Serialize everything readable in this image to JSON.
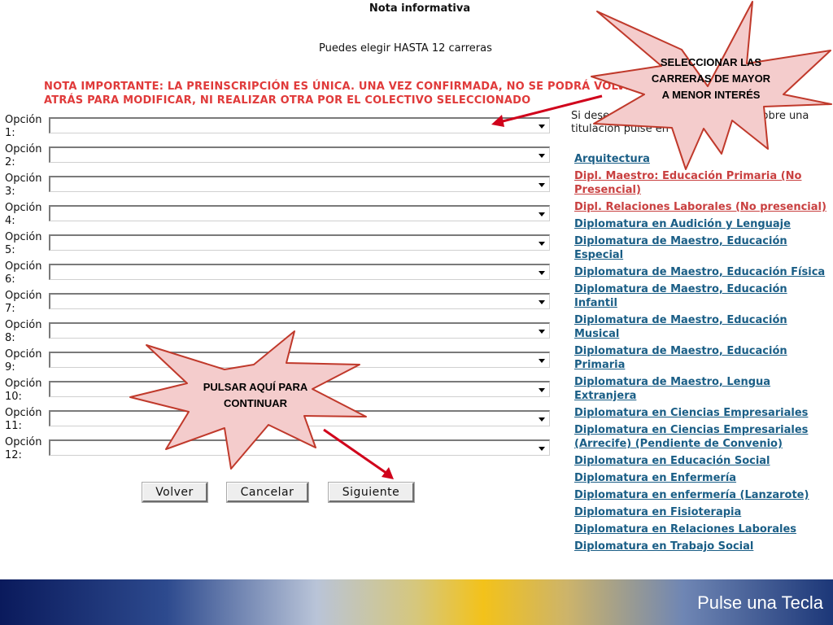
{
  "header": {
    "title": "Nota informativa",
    "subtitle": "Puedes elegir HASTA 12 carreras",
    "warning": "NOTA IMPORTANTE: LA PREINSCRIPCIÓN ES ÚNICA. UNA VEZ CONFIRMADA, NO SE PODRÁ VOLVER ATRÁS PARA MODIFICAR, NI REALIZAR OTRA POR EL COLECTIVO SELECCIONADO"
  },
  "options": [
    {
      "label": "Opción 1:",
      "value": ""
    },
    {
      "label": "Opción 2:",
      "value": ""
    },
    {
      "label": "Opción 3:",
      "value": ""
    },
    {
      "label": "Opción 4:",
      "value": ""
    },
    {
      "label": "Opción 5:",
      "value": ""
    },
    {
      "label": "Opción 6:",
      "value": ""
    },
    {
      "label": "Opción 7:",
      "value": ""
    },
    {
      "label": "Opción 8:",
      "value": ""
    },
    {
      "label": "Opción 9:",
      "value": ""
    },
    {
      "label": "Opción 10:",
      "value": ""
    },
    {
      "label": "Opción 11:",
      "value": ""
    },
    {
      "label": "Opción 12:",
      "value": ""
    }
  ],
  "buttons": {
    "back": "Volver",
    "cancel": "Cancelar",
    "next": "Siguiente"
  },
  "info_text": "Si desea conocer más información sobre una titulación pulse en su enlace",
  "degrees": [
    {
      "label": "Arquitectura",
      "color": "blue"
    },
    {
      "label": "Dipl. Maestro: Educación Primaria (No Presencial)",
      "color": "red"
    },
    {
      "label": "Dipl. Relaciones Laborales (No presencial)",
      "color": "red"
    },
    {
      "label": "Diplomatura en Audición y Lenguaje",
      "color": "blue"
    },
    {
      "label": "Diplomatura de Maestro, Educación Especial",
      "color": "blue"
    },
    {
      "label": "Diplomatura de Maestro, Educación Física",
      "color": "blue"
    },
    {
      "label": "Diplomatura de Maestro, Educación Infantil",
      "color": "blue"
    },
    {
      "label": "Diplomatura de Maestro, Educación Musical",
      "color": "blue"
    },
    {
      "label": "Diplomatura de Maestro, Educación Primaria",
      "color": "blue"
    },
    {
      "label": "Diplomatura de Maestro, Lengua Extranjera",
      "color": "blue"
    },
    {
      "label": "Diplomatura en Ciencias Empresariales",
      "color": "blue"
    },
    {
      "label": "Diplomatura en Ciencias Empresariales (Arrecife) (Pendiente de Convenio)",
      "color": "blue"
    },
    {
      "label": "Diplomatura en Educación Social",
      "color": "blue"
    },
    {
      "label": "Diplomatura en Enfermería",
      "color": "blue"
    },
    {
      "label": "Diplomatura en enfermería (Lanzarote)",
      "color": "blue"
    },
    {
      "label": "Diplomatura en Fisioterapia",
      "color": "blue"
    },
    {
      "label": "Diplomatura en Relaciones Laborales",
      "color": "blue"
    },
    {
      "label": "Diplomatura en Trabajo Social",
      "color": "blue"
    }
  ],
  "callouts": {
    "select_careers": "SELECCIONAR LAS CARRERAS DE MAYOR A MENOR INTERÉS",
    "continue": "PULSAR AQUÍ PARA CONTINUAR"
  },
  "footer": {
    "text": "Pulse una Tecla"
  },
  "colors": {
    "warning": "#e03a3a",
    "link": "#1a5e86",
    "link_red": "#c94040",
    "burst_fill": "#f4cccc",
    "burst_stroke": "#c0392b"
  }
}
